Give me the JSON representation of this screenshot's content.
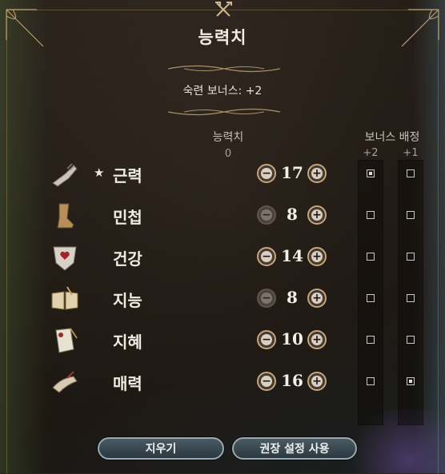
{
  "title": "능력치",
  "proficiency_bonus": "숙련 보너스: +2",
  "headers": {
    "ability_points": "능력치",
    "ability_points_remaining": "0",
    "bonus_allocation": "보너스 배정",
    "bonus_plus2": "+2",
    "bonus_plus1": "+1"
  },
  "abilities": [
    {
      "name": "근력",
      "value": "17",
      "star": "★",
      "icon": "gauntlet-icon",
      "minus_enabled": true,
      "plus_enabled": true,
      "bonus2": true,
      "bonus1": false
    },
    {
      "name": "민첩",
      "value": "8",
      "star": "",
      "icon": "boot-icon",
      "minus_enabled": false,
      "plus_enabled": true,
      "bonus2": false,
      "bonus1": false
    },
    {
      "name": "건강",
      "value": "14",
      "star": "",
      "icon": "shield-heart-icon",
      "minus_enabled": true,
      "plus_enabled": true,
      "bonus2": false,
      "bonus1": false
    },
    {
      "name": "지능",
      "value": "8",
      "star": "",
      "icon": "open-book-icon",
      "minus_enabled": false,
      "plus_enabled": true,
      "bonus2": false,
      "bonus1": false
    },
    {
      "name": "지혜",
      "value": "10",
      "star": "",
      "icon": "scroll-icon",
      "minus_enabled": true,
      "plus_enabled": true,
      "bonus2": false,
      "bonus1": false
    },
    {
      "name": "매력",
      "value": "16",
      "star": "",
      "icon": "hand-mask-icon",
      "minus_enabled": true,
      "plus_enabled": true,
      "bonus2": false,
      "bonus1": true
    }
  ],
  "buttons": {
    "clear": "지우기",
    "use_recommended": "권장 설정 사용"
  },
  "glyphs": {
    "minus": "−",
    "plus": "+"
  }
}
